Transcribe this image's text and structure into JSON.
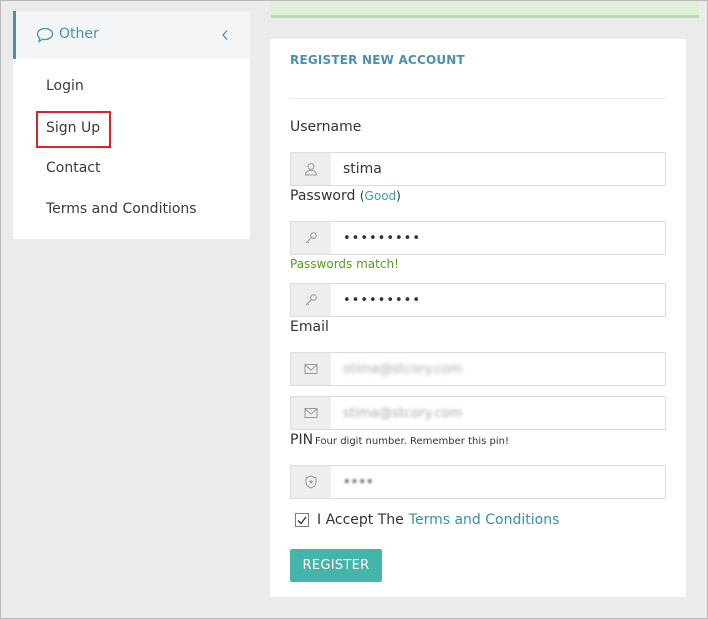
{
  "sidebar": {
    "header_label": "Other",
    "items": [
      {
        "label": "Login"
      },
      {
        "label": "Sign Up"
      },
      {
        "label": "Contact"
      },
      {
        "label": "Terms and Conditions"
      }
    ]
  },
  "form": {
    "title": "REGISTER NEW ACCOUNT",
    "username_label": "Username",
    "username_value": "stima",
    "password_label": "Password",
    "password_strength_open": "(",
    "password_strength": "Good",
    "password_strength_close": ")",
    "password_value": "•••••••••",
    "passwords_match_msg": "Passwords match!",
    "password_confirm_value": "•••••••••",
    "email_label": "Email",
    "email_value": "stima@stcory.com",
    "email_confirm_value": "stima@stcory.com",
    "pin_label": "PIN",
    "pin_hint": "Four digit number. Remember this pin!",
    "pin_value": "••••",
    "accept_text": "I Accept The",
    "accept_link": "Terms and Conditions",
    "accept_checked": true,
    "register_label": "REGISTER"
  },
  "icons": {
    "header": "chat-bubble-icon",
    "collapse": "chevron-left-icon",
    "username": "user-icon",
    "password": "key-icon",
    "email": "envelope-icon",
    "pin": "shield-icon",
    "checkbox": "checkmark-icon"
  },
  "colors": {
    "accent": "#4b8fb5",
    "button": "#43b5aa",
    "success": "#5a9a1e",
    "highlight_box": "#d9232e",
    "link": "#3a8eaa"
  }
}
